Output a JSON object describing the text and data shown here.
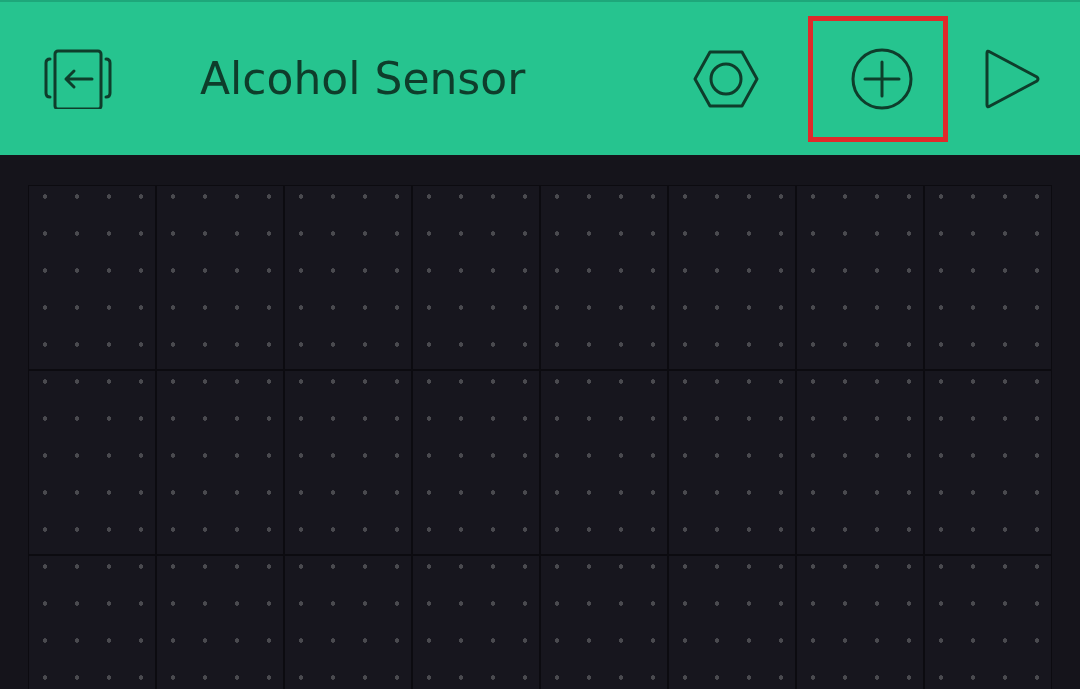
{
  "header": {
    "title": "Alcohol Sensor"
  },
  "actions": [
    {
      "kind": "settings",
      "highlighted": false
    },
    {
      "kind": "add",
      "highlighted": true
    },
    {
      "kind": "play",
      "highlighted": false
    }
  ]
}
